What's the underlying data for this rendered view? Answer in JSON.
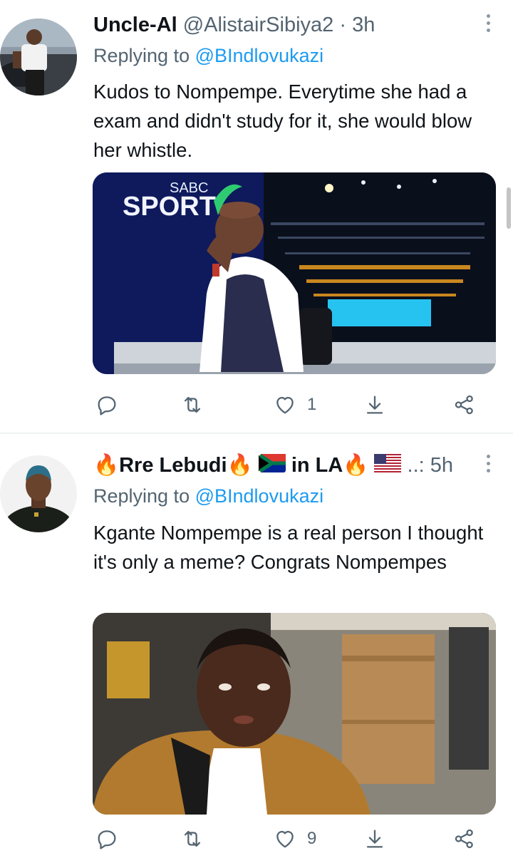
{
  "tweets": [
    {
      "author": {
        "name": "Uncle-Al",
        "handle": "@AlistairSibiya2",
        "separator": "·",
        "time": "3h"
      },
      "reply_prefix": "Replying to",
      "reply_to": "@BIndlovukazi",
      "text": "Kudos to Nompempe. Everytime she had a exam and didn't study for it, she would blow her whistle.",
      "media": {
        "overlay_text_top": "SABC",
        "overlay_text_main": "SPORT"
      },
      "actions": {
        "reply_count": "",
        "retweet_count": "",
        "like_count": "1"
      }
    },
    {
      "author": {
        "name_part1": "Rre Lebudi",
        "name_part2": "in LA",
        "ellipsis": "..:",
        "time": "5h"
      },
      "reply_prefix": "Replying to",
      "reply_to": "@BIndlovukazi",
      "text": "Kgante Nompempe is a real person I thought it's only a meme? Congrats Nompempes",
      "actions": {
        "reply_count": "",
        "retweet_count": "",
        "like_count": "9"
      }
    }
  ],
  "icons": {
    "reply": "speech-bubble-icon",
    "retweet": "retweet-icon",
    "like": "heart-icon",
    "share": "share-down-arrow-icon",
    "network": "share-nodes-icon",
    "more": "vertical-ellipsis-icon"
  },
  "colors": {
    "link": "#1d9bf0",
    "secondary_text": "#536471",
    "primary_text": "#0f1419",
    "divider": "#eff3f4"
  }
}
